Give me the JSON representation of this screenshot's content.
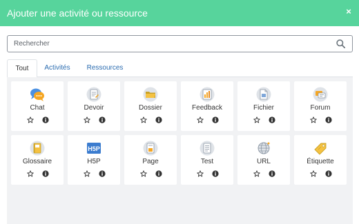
{
  "modal": {
    "title": "Ajouter une activité ou ressource",
    "close_glyph": "×"
  },
  "search": {
    "placeholder": "Rechercher",
    "value": ""
  },
  "tabs": [
    {
      "label": "Tout",
      "active": true
    },
    {
      "label": "Activités",
      "active": false
    },
    {
      "label": "Ressources",
      "active": false
    }
  ],
  "modules": [
    {
      "label": "Chat",
      "icon": "chat-icon"
    },
    {
      "label": "Devoir",
      "icon": "assignment-icon"
    },
    {
      "label": "Dossier",
      "icon": "folder-icon"
    },
    {
      "label": "Feedback",
      "icon": "feedback-icon"
    },
    {
      "label": "Fichier",
      "icon": "file-icon"
    },
    {
      "label": "Forum",
      "icon": "forum-icon"
    },
    {
      "label": "Glossaire",
      "icon": "glossary-icon"
    },
    {
      "label": "H5P",
      "icon": "h5p-icon"
    },
    {
      "label": "Page",
      "icon": "page-icon"
    },
    {
      "label": "Test",
      "icon": "quiz-icon"
    },
    {
      "label": "URL",
      "icon": "url-icon"
    },
    {
      "label": "Étiquette",
      "icon": "label-icon"
    }
  ],
  "colors": {
    "header": "#57d49c",
    "link": "#2b6cb0",
    "panel": "#f1f2f4"
  }
}
